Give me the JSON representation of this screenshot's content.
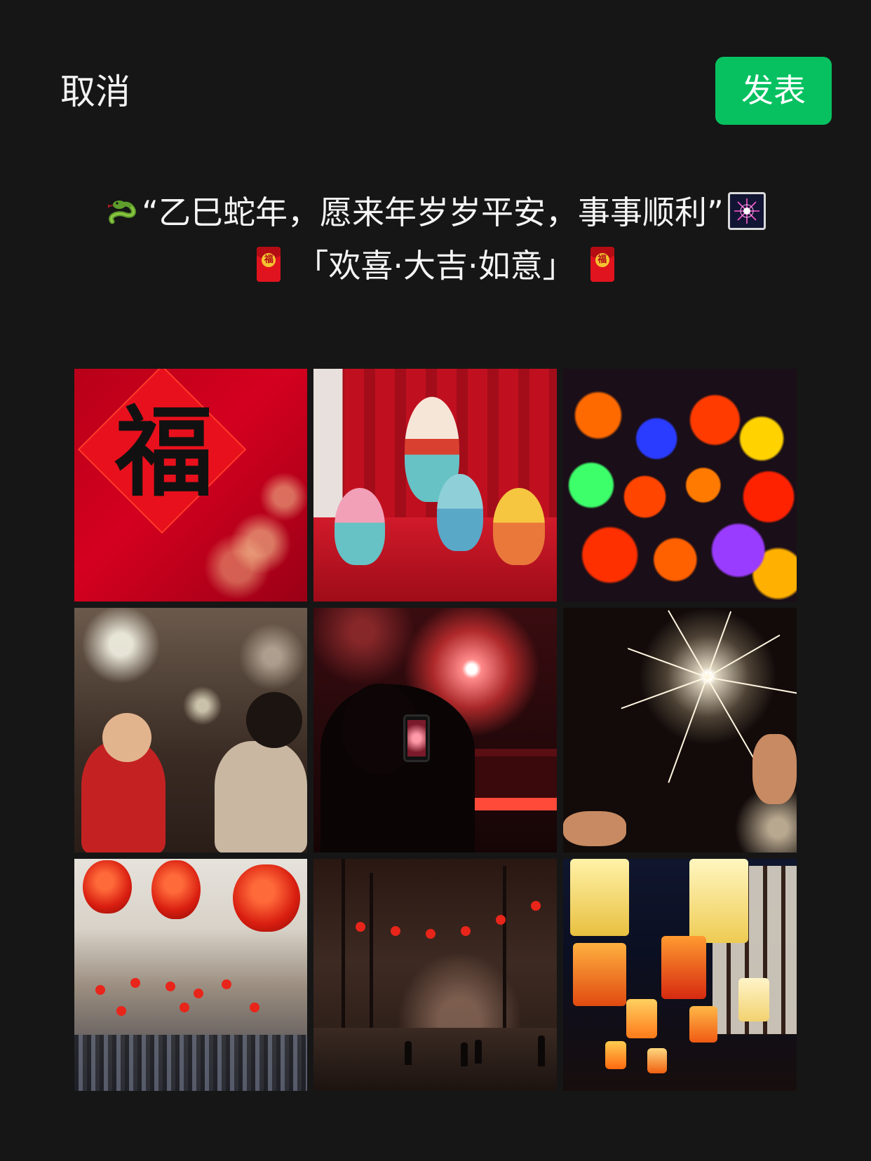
{
  "header": {
    "cancel_label": "取消",
    "publish_label": "发表",
    "publish_color": "#07c160"
  },
  "caption": {
    "line1_text": "“乙巳蛇年，愿来年岁岁平安，事事顺利”",
    "line1_leading_icon": "snake-emoji",
    "line1_trailing_icon": "fireworks-emoji",
    "line2_text": "「欢喜·大吉·如意」",
    "line2_icons": [
      "red-envelope-emoji",
      "red-envelope-emoji"
    ],
    "envelope_seal": "福"
  },
  "photo_grid": {
    "columns": 3,
    "rows": 3,
    "photos": [
      {
        "subject": "fu-character-decoration",
        "fu_text": "福"
      },
      {
        "subject": "snake-figurines"
      },
      {
        "subject": "colorful-lanterns"
      },
      {
        "subject": "children-watching-fireworks"
      },
      {
        "subject": "person-photographing-fireworks"
      },
      {
        "subject": "sparklers"
      },
      {
        "subject": "red-lanterns-crowded-street"
      },
      {
        "subject": "lantern-lit-night-street"
      },
      {
        "subject": "palace-lanterns-night"
      }
    ]
  }
}
